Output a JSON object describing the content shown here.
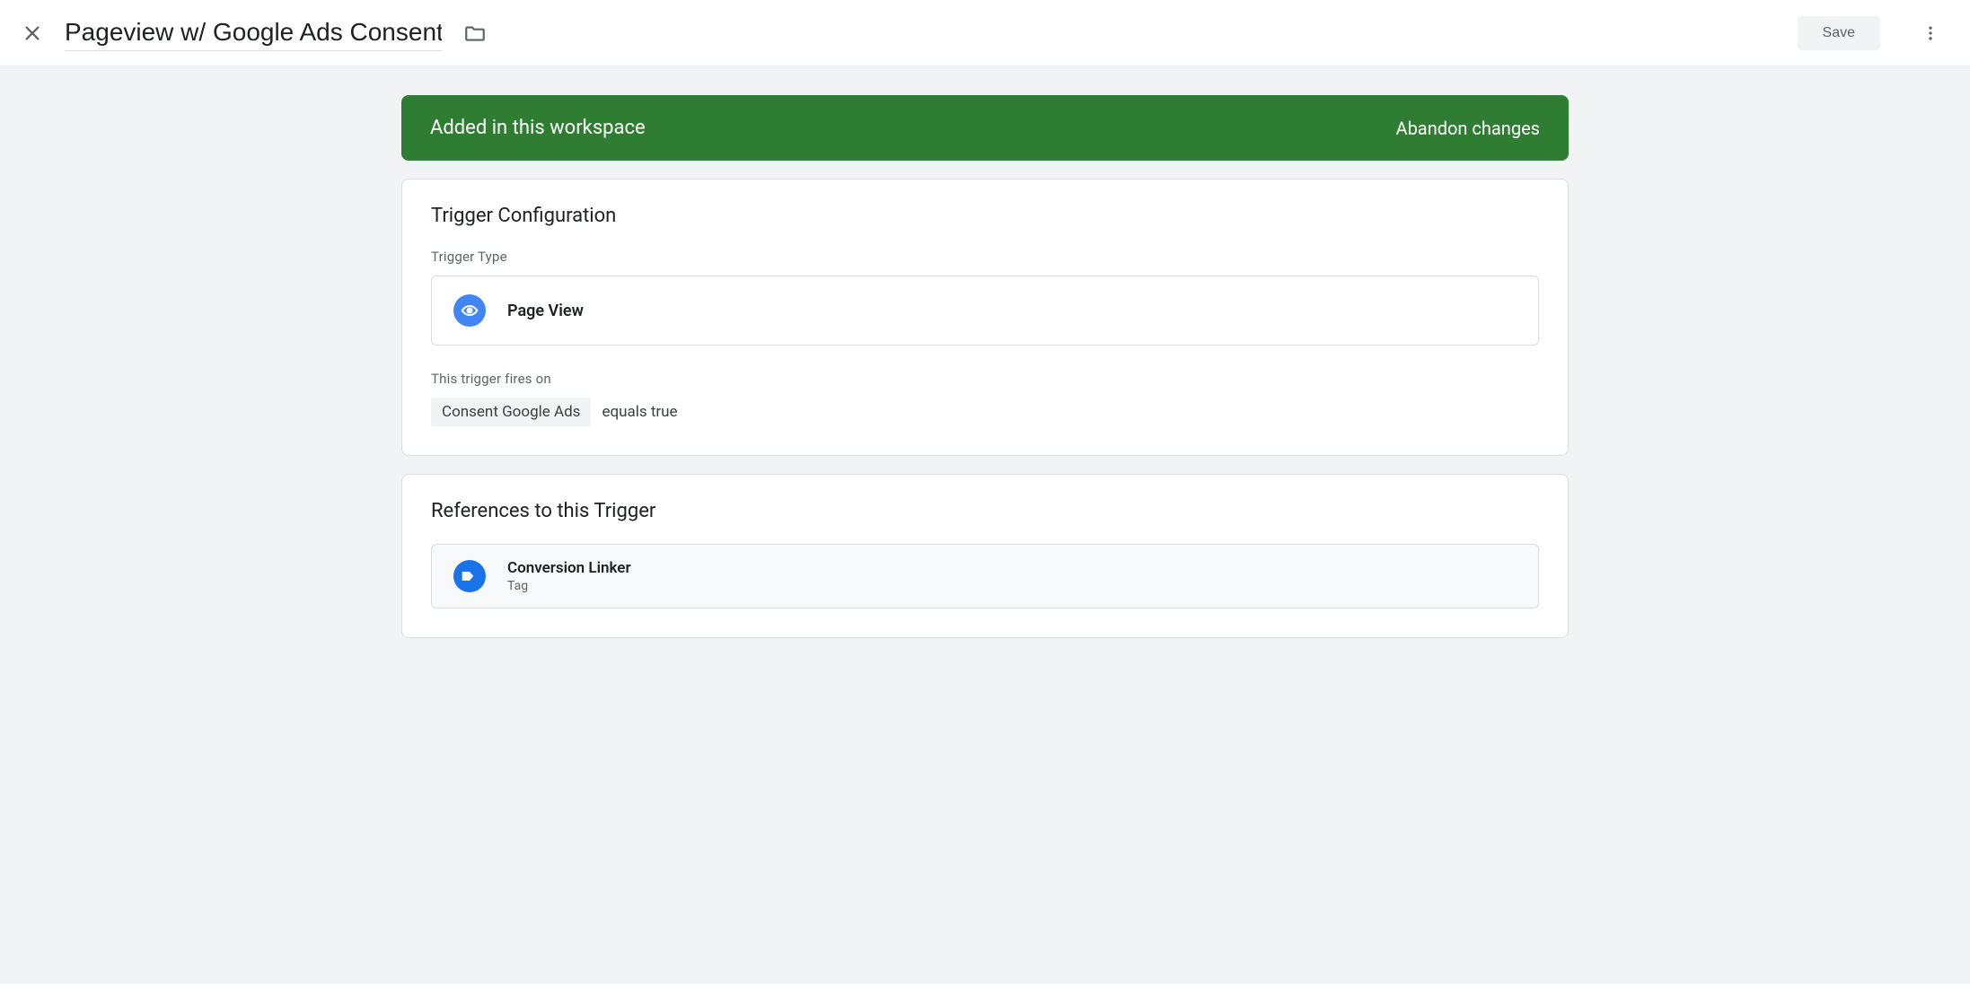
{
  "header": {
    "title": "Pageview w/ Google Ads Consent",
    "save_label": "Save"
  },
  "banner": {
    "message": "Added in this workspace",
    "action": "Abandon changes"
  },
  "trigger_config": {
    "section_title": "Trigger Configuration",
    "type_label": "Trigger Type",
    "type_value": "Page View",
    "fires_on_label": "This trigger fires on",
    "condition_variable": "Consent Google Ads",
    "condition_expression": "equals true"
  },
  "references": {
    "section_title": "References to this Trigger",
    "items": [
      {
        "name": "Conversion Linker",
        "type": "Tag"
      }
    ]
  }
}
